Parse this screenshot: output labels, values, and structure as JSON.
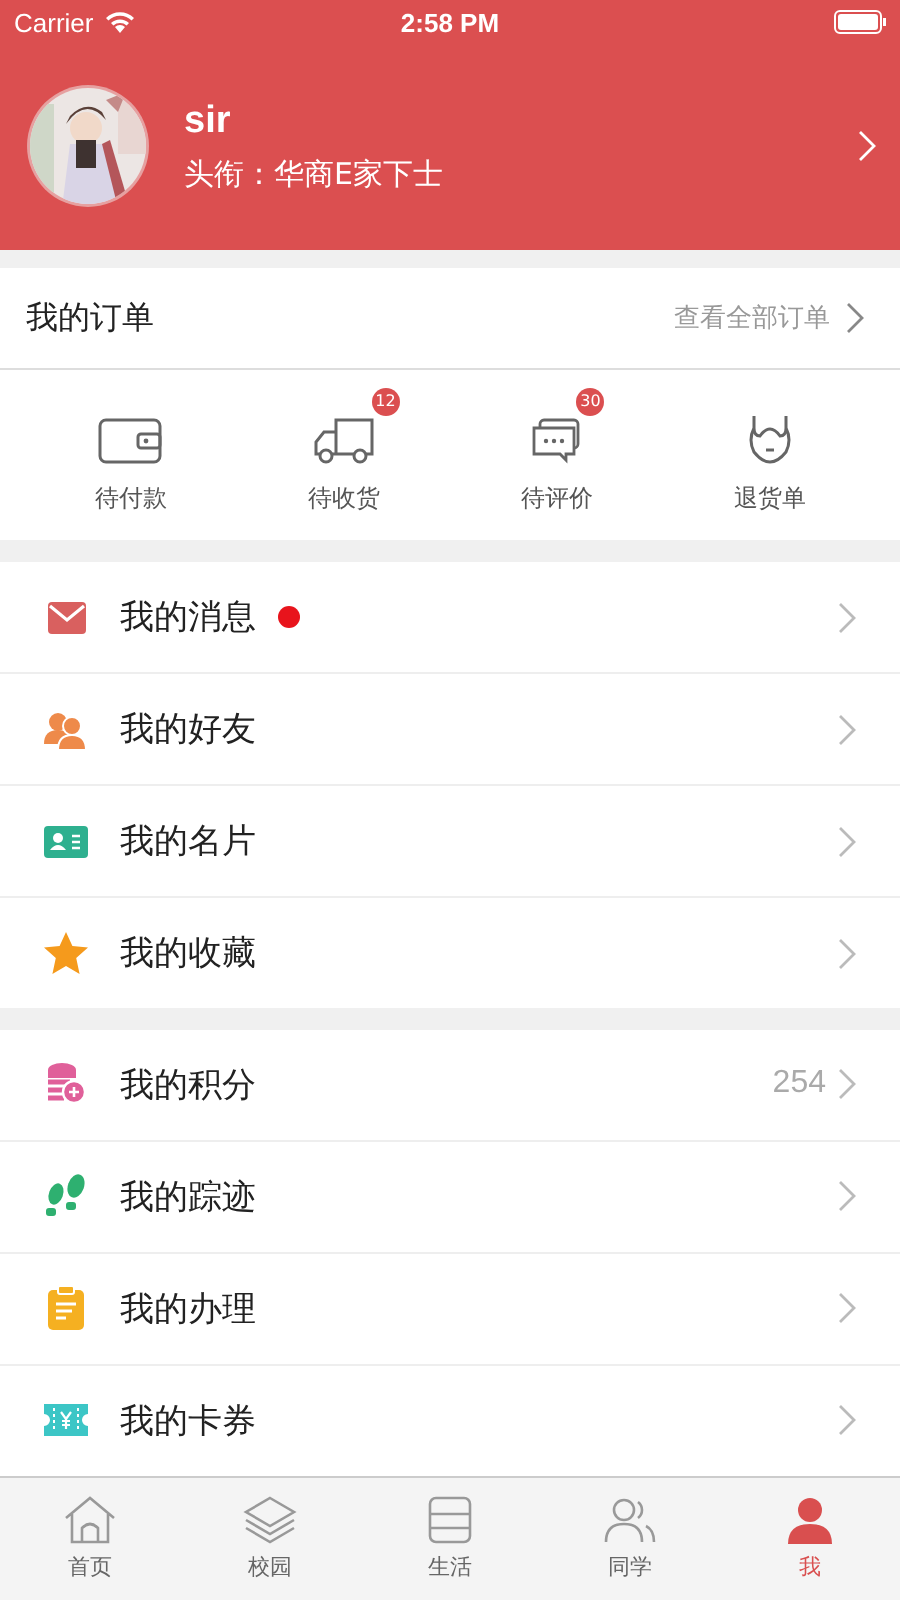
{
  "status_bar": {
    "carrier": "Carrier",
    "time": "2:58 PM"
  },
  "profile": {
    "name": "sir",
    "title": "头衔：华商E家下士"
  },
  "orders": {
    "title": "我的订单",
    "view_all": "查看全部订单",
    "items": [
      {
        "kind": "wallet",
        "label": "待付款"
      },
      {
        "kind": "truck",
        "label": "待收货",
        "badge": "12"
      },
      {
        "kind": "chat",
        "label": "待评价",
        "badge": "30"
      },
      {
        "kind": "return",
        "label": "退货单"
      }
    ]
  },
  "menu_groups": [
    [
      {
        "kind": "mail",
        "label": "我的消息",
        "unread": true
      },
      {
        "kind": "friends",
        "label": "我的好友",
        "unread": false
      },
      {
        "kind": "card",
        "label": "我的名片",
        "unread": false
      },
      {
        "kind": "star",
        "label": "我的收藏",
        "unread": false
      }
    ],
    [
      {
        "kind": "coins",
        "label": "我的积分",
        "unread": false,
        "value": "254"
      },
      {
        "kind": "steps",
        "label": "我的踪迹",
        "unread": false
      },
      {
        "kind": "clipboard",
        "label": "我的办理",
        "unread": false
      },
      {
        "kind": "ticket",
        "label": "我的卡券",
        "unread": false
      }
    ]
  ],
  "tab_bar": [
    {
      "kind": "home",
      "label": "首页",
      "selected": false
    },
    {
      "kind": "layers",
      "label": "校园",
      "selected": false
    },
    {
      "kind": "life",
      "label": "生活",
      "selected": false
    },
    {
      "kind": "classmates",
      "label": "同学",
      "selected": false
    },
    {
      "kind": "me",
      "label": "我",
      "selected": true
    }
  ]
}
